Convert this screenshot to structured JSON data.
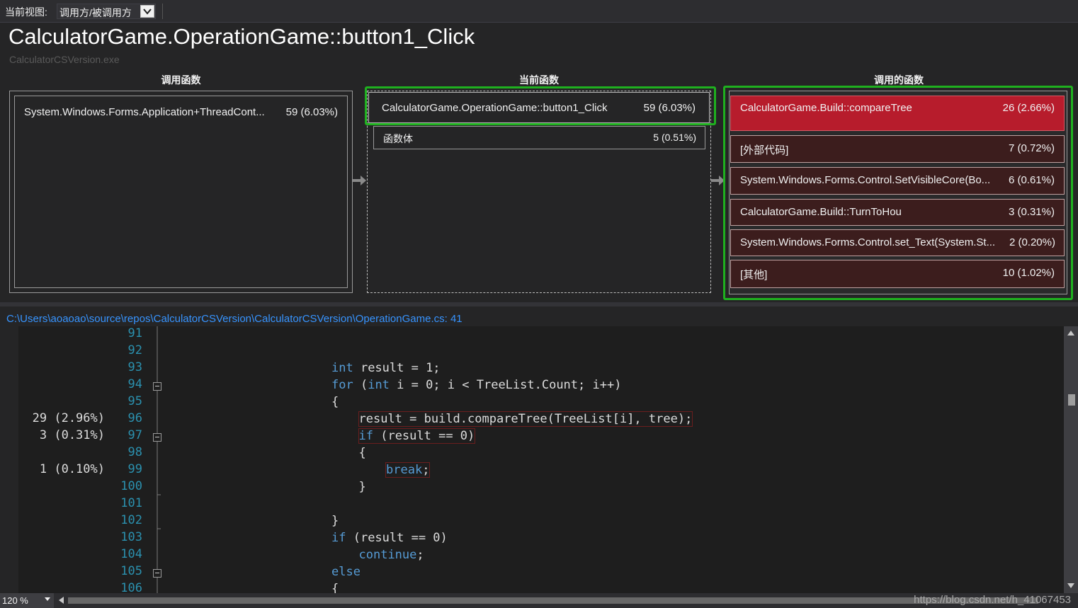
{
  "view_bar": {
    "label": "当前视图:",
    "view_value": "调用方/被调用方"
  },
  "header": {
    "title": "CalculatorGame.OperationGame::button1_Click",
    "subtitle": "CalculatorCSVersion.exe"
  },
  "columns": {
    "callers": "调用函数",
    "current": "当前函数",
    "callees": "调用的函数"
  },
  "callers": [
    {
      "name": "System.Windows.Forms.Application+ThreadCont...",
      "value": "59 (6.03%)"
    }
  ],
  "current": {
    "function": {
      "name": "CalculatorGame.OperationGame::button1_Click",
      "value": "59 (6.03%)"
    },
    "body": {
      "name": "函数体",
      "value": "5 (0.51%)"
    }
  },
  "callees": [
    {
      "name": "CalculatorGame.Build::compareTree",
      "value": "26 (2.66%)"
    },
    {
      "name": "[外部代码]",
      "value": "7 (0.72%)"
    },
    {
      "name": "System.Windows.Forms.Control.SetVisibleCore(Bo...",
      "value": "6 (0.61%)"
    },
    {
      "name": "CalculatorGame.Build::TurnToHou",
      "value": "3 (0.31%)"
    },
    {
      "name": "System.Windows.Forms.Control.set_Text(System.St...",
      "value": "2 (0.20%)"
    },
    {
      "name": "[其他]",
      "value": "10 (1.02%)"
    }
  ],
  "file_path": "C:\\Users\\aoaoao\\source\\repos\\CalculatorCSVersion\\CalculatorCSVersion\\OperationGame.cs: 41",
  "code": {
    "line_numbers": [
      "91",
      "92",
      "93",
      "94",
      "95",
      "96",
      "97",
      "98",
      "99",
      "100",
      "101",
      "102",
      "103",
      "104",
      "105",
      "106"
    ],
    "metrics": [
      {
        "line": "96",
        "value": "29 (2.96%)"
      },
      {
        "line": "97",
        "value": "3 (0.31%)"
      },
      {
        "line": "99",
        "value": "1 (0.10%)"
      }
    ],
    "lines": [
      {
        "no": "93",
        "indent": 6,
        "parts": [
          [
            "kw",
            "int"
          ],
          [
            "t",
            " result = 1;"
          ]
        ]
      },
      {
        "no": "94",
        "indent": 6,
        "parts": [
          [
            "kw",
            "for"
          ],
          [
            "t",
            " ("
          ],
          [
            "kw",
            "int"
          ],
          [
            "t",
            " i = 0; i < TreeList.Count; i++)"
          ]
        ]
      },
      {
        "no": "95",
        "indent": 6,
        "parts": [
          [
            "t",
            "{"
          ]
        ]
      },
      {
        "no": "96",
        "indent": 7,
        "hl": true,
        "parts": [
          [
            "t",
            "result = build.compareTree(TreeList[i], tree);"
          ]
        ]
      },
      {
        "no": "97",
        "indent": 7,
        "hl": true,
        "parts": [
          [
            "kw",
            "if"
          ],
          [
            "t",
            " (result == 0)"
          ]
        ]
      },
      {
        "no": "98",
        "indent": 7,
        "parts": [
          [
            "t",
            "{"
          ]
        ]
      },
      {
        "no": "99",
        "indent": 8,
        "hl": true,
        "parts": [
          [
            "kw",
            "break"
          ],
          [
            "t",
            ";"
          ]
        ]
      },
      {
        "no": "100",
        "indent": 7,
        "parts": [
          [
            "t",
            "}"
          ]
        ]
      },
      {
        "no": "102",
        "indent": 6,
        "parts": [
          [
            "t",
            "}"
          ]
        ]
      },
      {
        "no": "103",
        "indent": 6,
        "parts": [
          [
            "kw",
            "if"
          ],
          [
            "t",
            " (result == 0)"
          ]
        ]
      },
      {
        "no": "104",
        "indent": 7,
        "parts": [
          [
            "kw",
            "continue"
          ],
          [
            "t",
            ";"
          ]
        ]
      },
      {
        "no": "105",
        "indent": 6,
        "parts": [
          [
            "kw",
            "else"
          ]
        ]
      },
      {
        "no": "106",
        "indent": 6,
        "parts": [
          [
            "t",
            "{"
          ]
        ]
      }
    ]
  },
  "bottom": {
    "zoom": "120 %",
    "watermark": "https://blog.csdn.net/h_41067453"
  },
  "colors": {
    "highlight_box": "#1fb01f",
    "hot_callee": "#b71c2c",
    "callee_bg": "#3c1d1d",
    "line_number": "#2b91af",
    "keyword": "#569cd6",
    "path_link": "#3794ff"
  }
}
